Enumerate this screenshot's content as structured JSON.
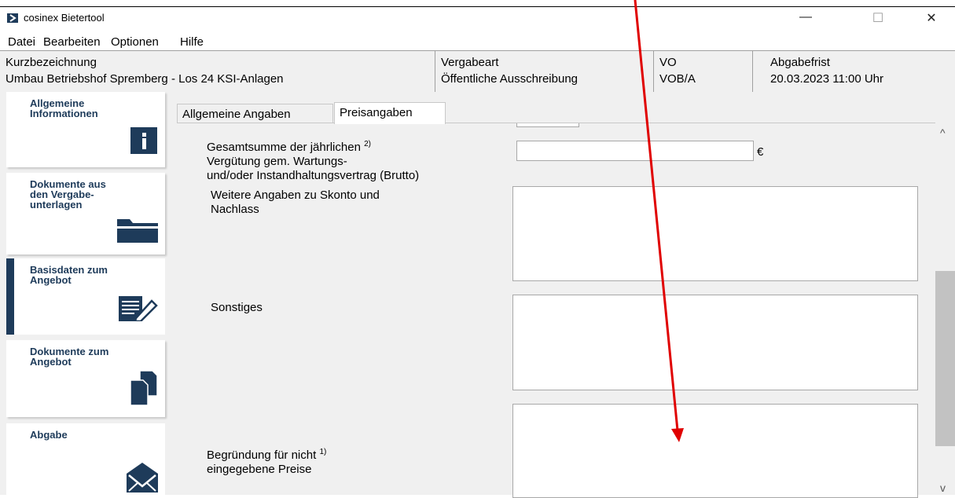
{
  "window": {
    "title": "cosinex Bietertool",
    "controls": {
      "minimize": "—",
      "maximize": "☐",
      "close": "✕"
    }
  },
  "menu": [
    "Datei",
    "Bearbeiten",
    "Optionen",
    "Hilfe"
  ],
  "header": {
    "kurzbezeichnung_label": "Kurzbezeichnung",
    "kurzbezeichnung_value": "Umbau Betriebshof Spremberg - Los 24 KSI-Anlagen",
    "vergabeart_label": "Vergabeart",
    "vergabeart_value": "Öffentliche Ausschreibung",
    "vo_label": "VO",
    "vo_value": "VOB/A",
    "abgabefrist_label": "Abgabefrist",
    "abgabefrist_value": "20.03.2023 11:00 Uhr"
  },
  "sidebar": {
    "items": [
      {
        "label": "Allgemeine\nInformationen",
        "icon": "info-icon"
      },
      {
        "label": "Dokumente aus\nden Vergabe-\nunterlagen",
        "icon": "folder-icon"
      },
      {
        "label": "Basisdaten zum\nAngebot",
        "icon": "edit-document-icon",
        "active": true
      },
      {
        "label": "Dokumente zum\nAngebot",
        "icon": "documents-icon"
      },
      {
        "label": "Abgabe",
        "icon": "envelope-icon"
      }
    ]
  },
  "tabs": [
    "Allgemeine Angaben",
    "Preisangaben"
  ],
  "active_tab": "Preisangaben",
  "form": {
    "gesamtsumme_label_line1": "Gesamtsumme der jährlichen",
    "gesamtsumme_sup": "2)",
    "gesamtsumme_label_line2": "Vergütung gem. Wartungs-",
    "gesamtsumme_label_line3": "und/oder Instandhaltungsvertrag (Brutto)",
    "gesamtsumme_value": "",
    "currency": "€",
    "skonto_label_line1": "Weitere Angaben zu Skonto und",
    "skonto_label_line2": "Nachlass",
    "skonto_value": "",
    "sonstiges_label": "Sonstiges",
    "sonstiges_value": "",
    "begruendung_label_line1": "Begründung für nicht",
    "begruendung_sup": "1)",
    "begruendung_label_line2": "eingegebene Preise",
    "begruendung_value": ""
  },
  "colors": {
    "accent": "#1e3b5a",
    "annotation_arrow": "#e00000"
  }
}
